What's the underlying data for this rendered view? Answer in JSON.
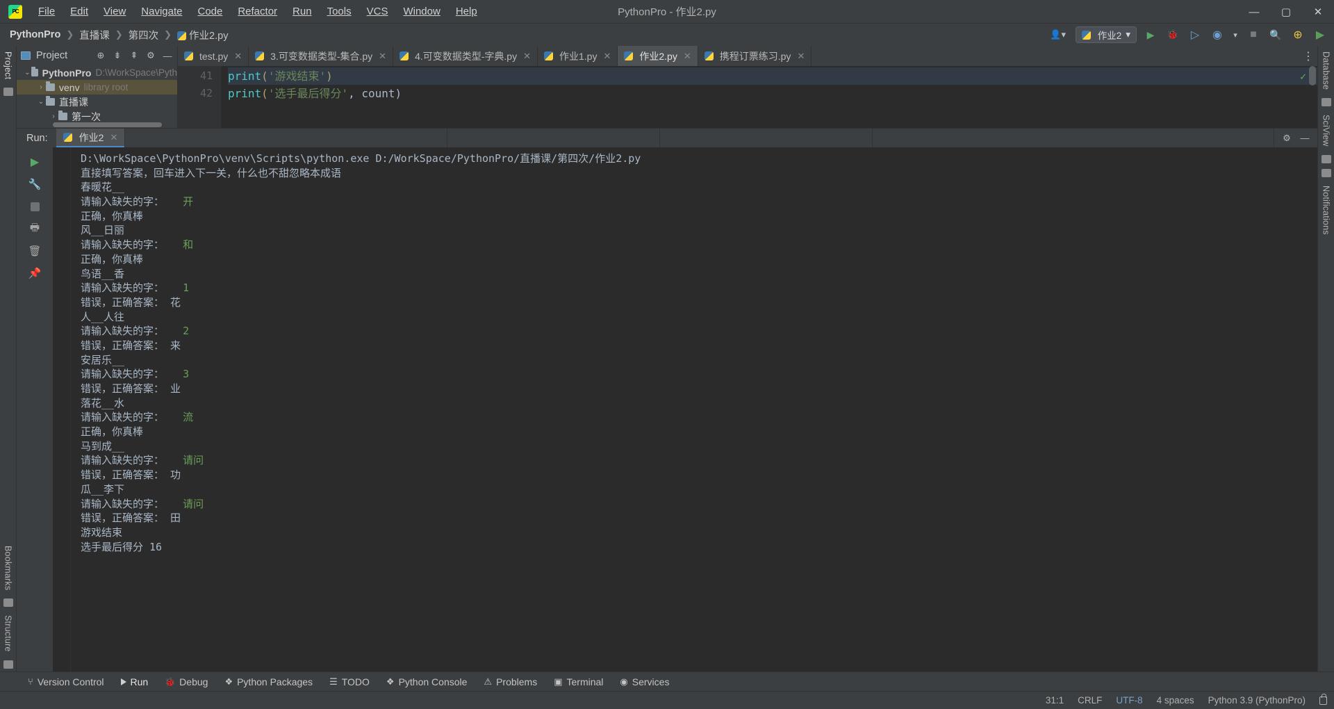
{
  "window": {
    "title": "PythonPro - 作业2.py",
    "logo_text": "PC",
    "minimize": "—",
    "maximize": "▢",
    "close": "✕"
  },
  "menu": {
    "items": [
      {
        "label": "File"
      },
      {
        "label": "Edit"
      },
      {
        "label": "View"
      },
      {
        "label": "Navigate"
      },
      {
        "label": "Code"
      },
      {
        "label": "Refactor"
      },
      {
        "label": "Run"
      },
      {
        "label": "Tools"
      },
      {
        "label": "VCS"
      },
      {
        "label": "Window"
      },
      {
        "label": "Help"
      }
    ]
  },
  "breadcrumb": {
    "items": [
      "PythonPro",
      "直播课",
      "第四次",
      "作业2.py"
    ],
    "separator": "❯"
  },
  "navbar_right": {
    "user_icon": "👤",
    "user_caret": "▾",
    "run_config": "作业2",
    "run_config_caret": "▾",
    "run_button": "▶",
    "debug_button": "🐞",
    "run_coverage": "▶",
    "profile": "▶",
    "profile_caret": "▾",
    "stop_button": "■",
    "search_icon": "🔍",
    "plugin_icon": "+",
    "share_icon": "▶"
  },
  "left_stripe": {
    "project_label": "Project",
    "bookmarks_label": "Bookmarks",
    "structure_label": "Structure"
  },
  "right_stripe": {
    "database_label": "Database",
    "sciview_label": "SciView",
    "notifications_label": "Notifications"
  },
  "project_panel": {
    "title": "Project",
    "toolbar_icons": [
      "target-icon",
      "collapse-icon",
      "expand-icon",
      "settings-icon",
      "minimize-icon"
    ],
    "tree": [
      {
        "indent": 0,
        "arrow": "⌄",
        "name": "PythonPro",
        "bold": true,
        "sub": "D:\\WorkSpace\\Pyth",
        "selected": false
      },
      {
        "indent": 1,
        "arrow": "›",
        "name": "venv",
        "bold": false,
        "sub": "library root",
        "selected": true
      },
      {
        "indent": 1,
        "arrow": "⌄",
        "name": "直播课",
        "bold": false,
        "sub": "",
        "selected": false
      },
      {
        "indent": 2,
        "arrow": "›",
        "name": "第一次",
        "bold": false,
        "sub": "",
        "selected": false
      }
    ]
  },
  "editor_tabs": [
    {
      "label": "test.py",
      "active": false
    },
    {
      "label": "3.可变数据类型-集合.py",
      "active": false
    },
    {
      "label": "4.可变数据类型-字典.py",
      "active": false
    },
    {
      "label": "作业1.py",
      "active": false
    },
    {
      "label": "作业2.py",
      "active": true
    },
    {
      "label": "携程订票练习.py",
      "active": false
    }
  ],
  "editor_tab_close": "✕",
  "editor_menu_icon": "⋮",
  "code": {
    "lines": [
      {
        "number": "41",
        "fn": "print",
        "open": "(",
        "str": "'游戏结束'",
        "rest": ")",
        "highlight": true
      },
      {
        "number": "42",
        "fn": "print",
        "open": "(",
        "str": "'选手最后得分'",
        "rest": ", count)",
        "highlight": false
      }
    ],
    "inspection_badge": "✓"
  },
  "run_panel": {
    "label": "Run:",
    "tab": "作业2",
    "tab_close": "✕",
    "settings_icon": "⚙",
    "minimize_icon": "—",
    "tools": [
      "rerun-icon",
      "scroll-up-icon",
      "scroll-down-icon",
      "stop-icon",
      "soft-wrap-icon",
      "scroll-to-end-icon",
      "print-icon",
      "trash-icon",
      "pin-icon",
      "settings-icon"
    ],
    "console_lines": [
      {
        "text": "D:\\WorkSpace\\PythonPro\\venv\\Scripts\\python.exe D:/WorkSpace/PythonPro/直播课/第四次/作业2.py",
        "input": ""
      },
      {
        "text": "直接填写答案，回车进入下一关，什么也不甜忽略本成语",
        "input": ""
      },
      {
        "text": "春暖花__",
        "input": ""
      },
      {
        "text": "请输入缺失的字：",
        "input": "   开"
      },
      {
        "text": "正确，你真棒",
        "input": ""
      },
      {
        "text": "风__日丽",
        "input": ""
      },
      {
        "text": "请输入缺失的字：",
        "input": "   和"
      },
      {
        "text": "正确，你真棒",
        "input": ""
      },
      {
        "text": "鸟语__香",
        "input": ""
      },
      {
        "text": "请输入缺失的字：",
        "input": "   1"
      },
      {
        "text": "错误，正确答案： 花",
        "input": ""
      },
      {
        "text": "人__人往",
        "input": ""
      },
      {
        "text": "请输入缺失的字：",
        "input": "   2"
      },
      {
        "text": "错误，正确答案： 来",
        "input": ""
      },
      {
        "text": "安居乐__",
        "input": ""
      },
      {
        "text": "请输入缺失的字：",
        "input": "   3"
      },
      {
        "text": "错误，正确答案： 业",
        "input": ""
      },
      {
        "text": "落花__水",
        "input": ""
      },
      {
        "text": "请输入缺失的字：",
        "input": "   流"
      },
      {
        "text": "正确，你真棒",
        "input": ""
      },
      {
        "text": "马到成__",
        "input": ""
      },
      {
        "text": "请输入缺失的字：",
        "input": "   请问"
      },
      {
        "text": "错误，正确答案： 功",
        "input": ""
      },
      {
        "text": "瓜__李下",
        "input": ""
      },
      {
        "text": "请输入缺失的字：",
        "input": "   请问"
      },
      {
        "text": "错误，正确答案： 田",
        "input": ""
      },
      {
        "text": "游戏结束",
        "input": ""
      },
      {
        "text": "选手最后得分 16",
        "input": ""
      }
    ]
  },
  "tool_strip": [
    {
      "label": "Version Control",
      "icon": "branch-icon",
      "active": false
    },
    {
      "label": "Run",
      "icon": "play-icon",
      "active": true
    },
    {
      "label": "Debug",
      "icon": "bug-icon",
      "active": false
    },
    {
      "label": "Python Packages",
      "icon": "package-icon",
      "active": false
    },
    {
      "label": "TODO",
      "icon": "list-icon",
      "active": false
    },
    {
      "label": "Python Console",
      "icon": "console-icon",
      "active": false
    },
    {
      "label": "Problems",
      "icon": "warning-icon",
      "active": false
    },
    {
      "label": "Terminal",
      "icon": "terminal-icon",
      "active": false
    },
    {
      "label": "Services",
      "icon": "services-icon",
      "active": false
    }
  ],
  "status_bar": {
    "caret": "31:1",
    "line_sep": "CRLF",
    "encoding": "UTF-8",
    "indent": "4 spaces",
    "interpreter": "Python 3.9 (PythonPro)",
    "lock_icon": "lock-icon"
  }
}
